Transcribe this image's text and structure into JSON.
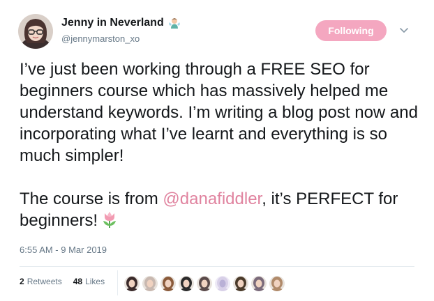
{
  "author": {
    "display_name": "Jenny in Neverland",
    "handle": "@jennymarston_xo",
    "avatar_icon": "avatar-photo",
    "name_emoji_icon": "fairy-emoji-icon"
  },
  "follow_button": {
    "label": "Following",
    "color": "#f4a7c0"
  },
  "menu": {
    "icon": "chevron-down-icon"
  },
  "tweet": {
    "paragraph1": "I’ve just been working through a FREE SEO for beginners course which has massively helped me understand keywords. I’m writing a blog post now and incorporating what I’ve learnt and everything is so much simpler!",
    "paragraph2_prefix": "The course is from ",
    "mention": "@danafiddler",
    "paragraph2_suffix": ", it’s PERFECT for beginners!",
    "end_emoji_icon": "tulip-emoji-icon",
    "mention_color": "#e0839f"
  },
  "timestamp": "6:55 AM - 9 Mar 2019",
  "stats": {
    "retweets_count": "2",
    "retweets_label": "Retweets",
    "likes_count": "48",
    "likes_label": "Likes"
  },
  "likers": [
    {
      "icon": "liker-avatar-1",
      "color": "#3a2a2a"
    },
    {
      "icon": "liker-avatar-2",
      "color": "#c8b8b0"
    },
    {
      "icon": "liker-avatar-3",
      "color": "#8a5a3a"
    },
    {
      "icon": "liker-avatar-4",
      "color": "#2a2a2a"
    },
    {
      "icon": "liker-avatar-5",
      "color": "#5a4a4a"
    },
    {
      "icon": "liker-avatar-6",
      "color": "#d8d0e8"
    },
    {
      "icon": "liker-avatar-7",
      "color": "#4a3a2a"
    },
    {
      "icon": "liker-avatar-8",
      "color": "#7a6a7a"
    },
    {
      "icon": "liker-avatar-9",
      "color": "#b08a6a"
    }
  ]
}
